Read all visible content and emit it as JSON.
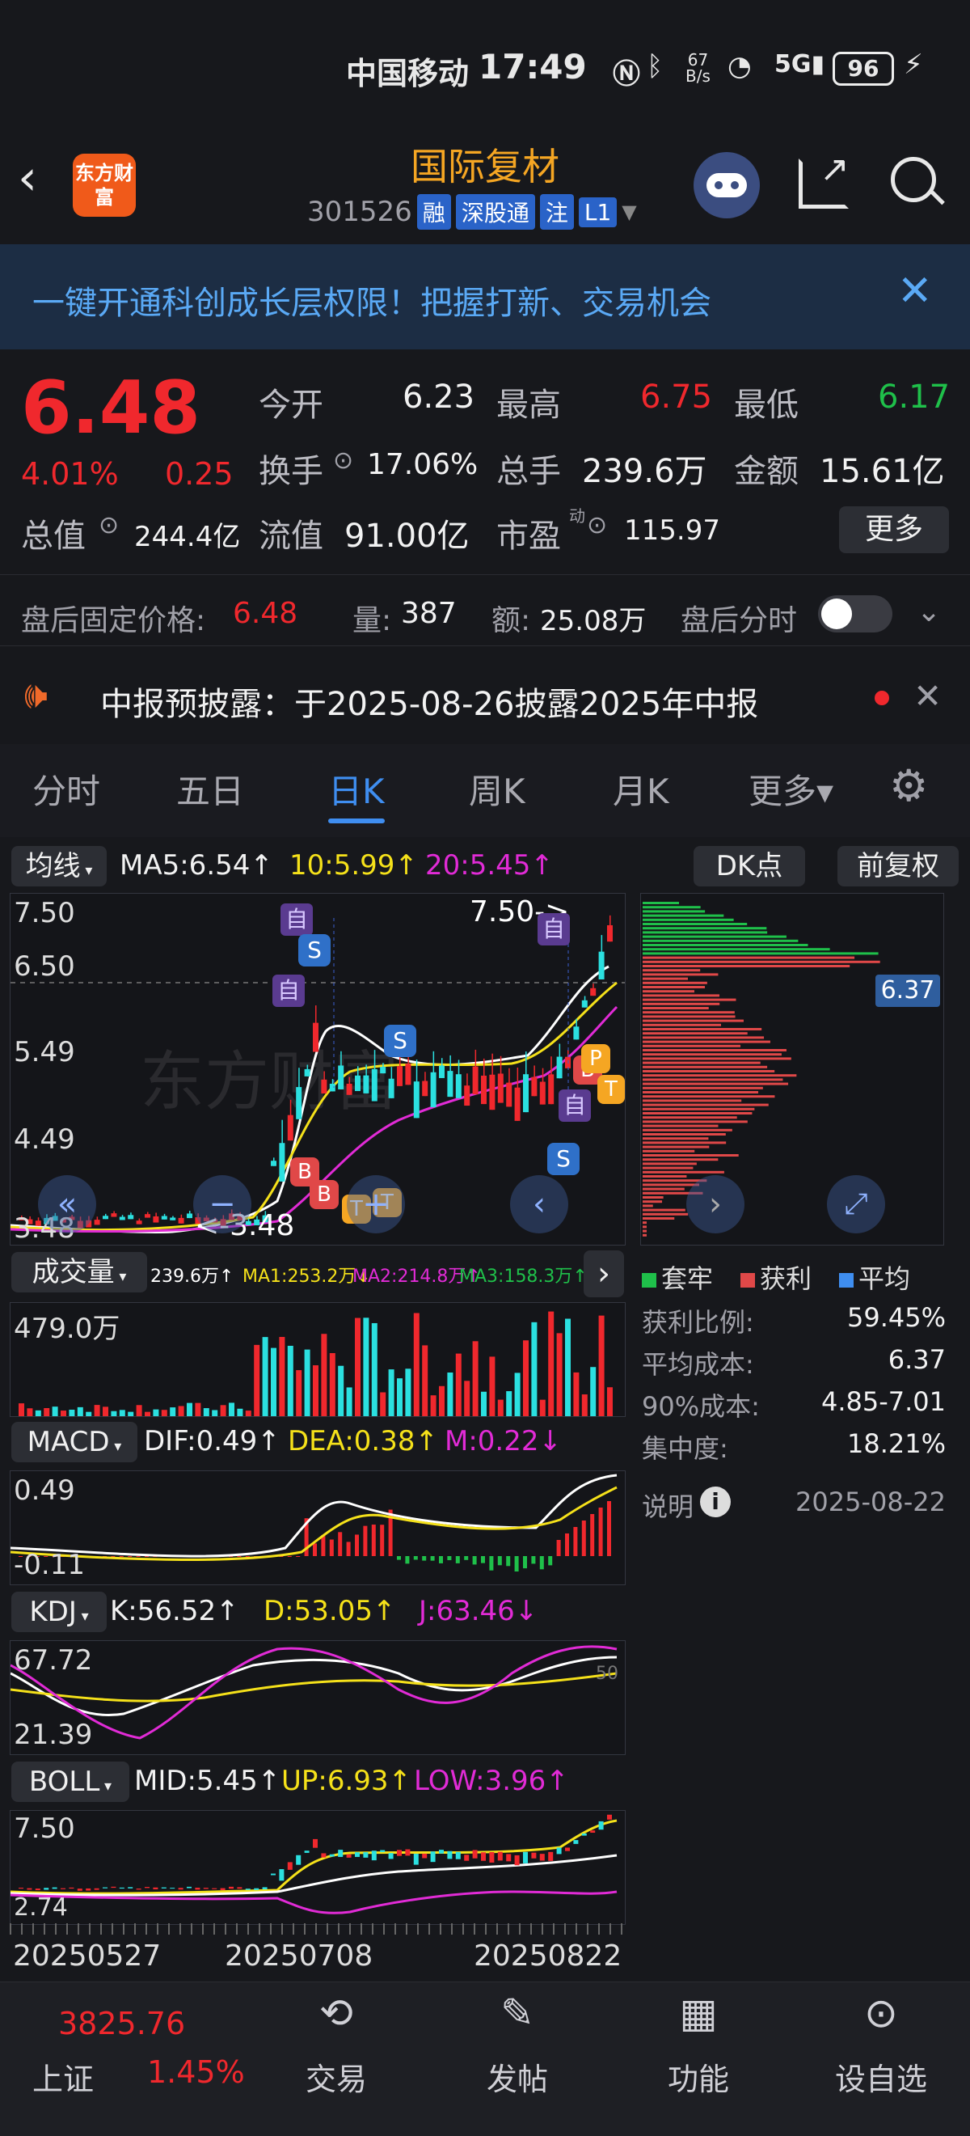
{
  "status_bar": {
    "carrier": "中国移动",
    "time": "17:49",
    "net_speed_top": "67",
    "net_speed_unit": "B/s",
    "battery": "96"
  },
  "header": {
    "stock_name": "国际复材",
    "logo_text": "东方财富",
    "code": "301526",
    "tags": [
      "融",
      "深股通",
      "注",
      "L1"
    ]
  },
  "banner": {
    "text": "一键开通科创成长层权限！把握打新、交易机会"
  },
  "quote": {
    "price": "6.48",
    "change_pct": "4.01%",
    "change": "0.25",
    "open_label": "今开",
    "open": "6.23",
    "high_label": "最高",
    "high": "6.75",
    "low_label": "最低",
    "low": "6.17",
    "turnover_label": "换手",
    "turnover": "17.06%",
    "volume_label": "总手",
    "volume": "239.6万",
    "amount_label": "金额",
    "amount": "15.61亿",
    "mktcap_label": "总值",
    "mktcap": "244.4亿",
    "float_label": "流值",
    "float": "91.00亿",
    "pe_label": "市盈",
    "pe_sup": "动",
    "pe": "115.97",
    "more_label": "更多"
  },
  "after_hours": {
    "price_label": "盘后固定价格:",
    "price": "6.48",
    "vol_label": "量:",
    "vol": "387",
    "amt_label": "额:",
    "amt": "25.08万",
    "toggle_label": "盘后分时"
  },
  "notice": {
    "text": "中报预披露：于2025-08-26披露2025年中报"
  },
  "tabs": [
    "分时",
    "五日",
    "日K",
    "周K",
    "月K",
    "更多▾"
  ],
  "active_tab": 2,
  "ma_row": {
    "selector": "均线",
    "ma5": "MA5:6.54↑",
    "ma10": "10:5.99↑",
    "ma20": "20:5.45↑",
    "dk": "DK点",
    "fq": "前复权"
  },
  "kline": {
    "y_labels": [
      "7.50",
      "6.50",
      "5.49",
      "4.49",
      "3.48"
    ],
    "high_marker": "7.50->",
    "low_marker": "<-3.48",
    "chip_price": "6.37",
    "markers": [
      "自",
      "S",
      "自",
      "S",
      "自",
      "自",
      "S",
      "B",
      "B",
      "T",
      "T",
      "B",
      "P",
      "T"
    ]
  },
  "volume": {
    "selector": "成交量",
    "vol": "239.6万↑",
    "ma1": "MA1:253.2万↓",
    "ma2": "MA2:214.8万↑",
    "ma3": "MA3:158.3万↑",
    "y_label": "479.0万"
  },
  "macd": {
    "selector": "MACD",
    "dif": "DIF:0.49↑",
    "dea": "DEA:0.38↑",
    "m": "M:0.22↓",
    "y_top": "0.49",
    "y_bottom": "-0.11"
  },
  "kdj": {
    "selector": "KDJ",
    "k": "K:56.52↑",
    "d": "D:53.05↑",
    "j": "J:63.46↓",
    "y_top": "67.72",
    "y_bottom": "21.39",
    "y_right": "50"
  },
  "boll": {
    "selector": "BOLL",
    "mid": "MID:5.45↑",
    "up": "UP:6.93↑",
    "low": "LOW:3.96↑",
    "y_top": "7.50",
    "y_bottom": "2.74"
  },
  "dates": [
    "20250527",
    "20250708",
    "20250822"
  ],
  "chips": {
    "legend": [
      "套牢",
      "获利",
      "平均"
    ],
    "stats": [
      {
        "label": "获利比例:",
        "value": "59.45%"
      },
      {
        "label": "平均成本:",
        "value": "6.37"
      },
      {
        "label": "90%成本:",
        "value": "4.85-7.01"
      },
      {
        "label": "集中度:",
        "value": "18.21%"
      }
    ],
    "note_label": "说明",
    "date": "2025-08-22"
  },
  "bottom_nav": {
    "index_value": "3825.76",
    "index_name": "上证",
    "index_pct": "1.45%",
    "items": [
      "交易",
      "发帖",
      "功能",
      "设自选"
    ]
  },
  "colors": {
    "up": "#f0282d",
    "down": "#1fc04a",
    "accent": "#f5a623",
    "blue": "#2f7de1"
  }
}
